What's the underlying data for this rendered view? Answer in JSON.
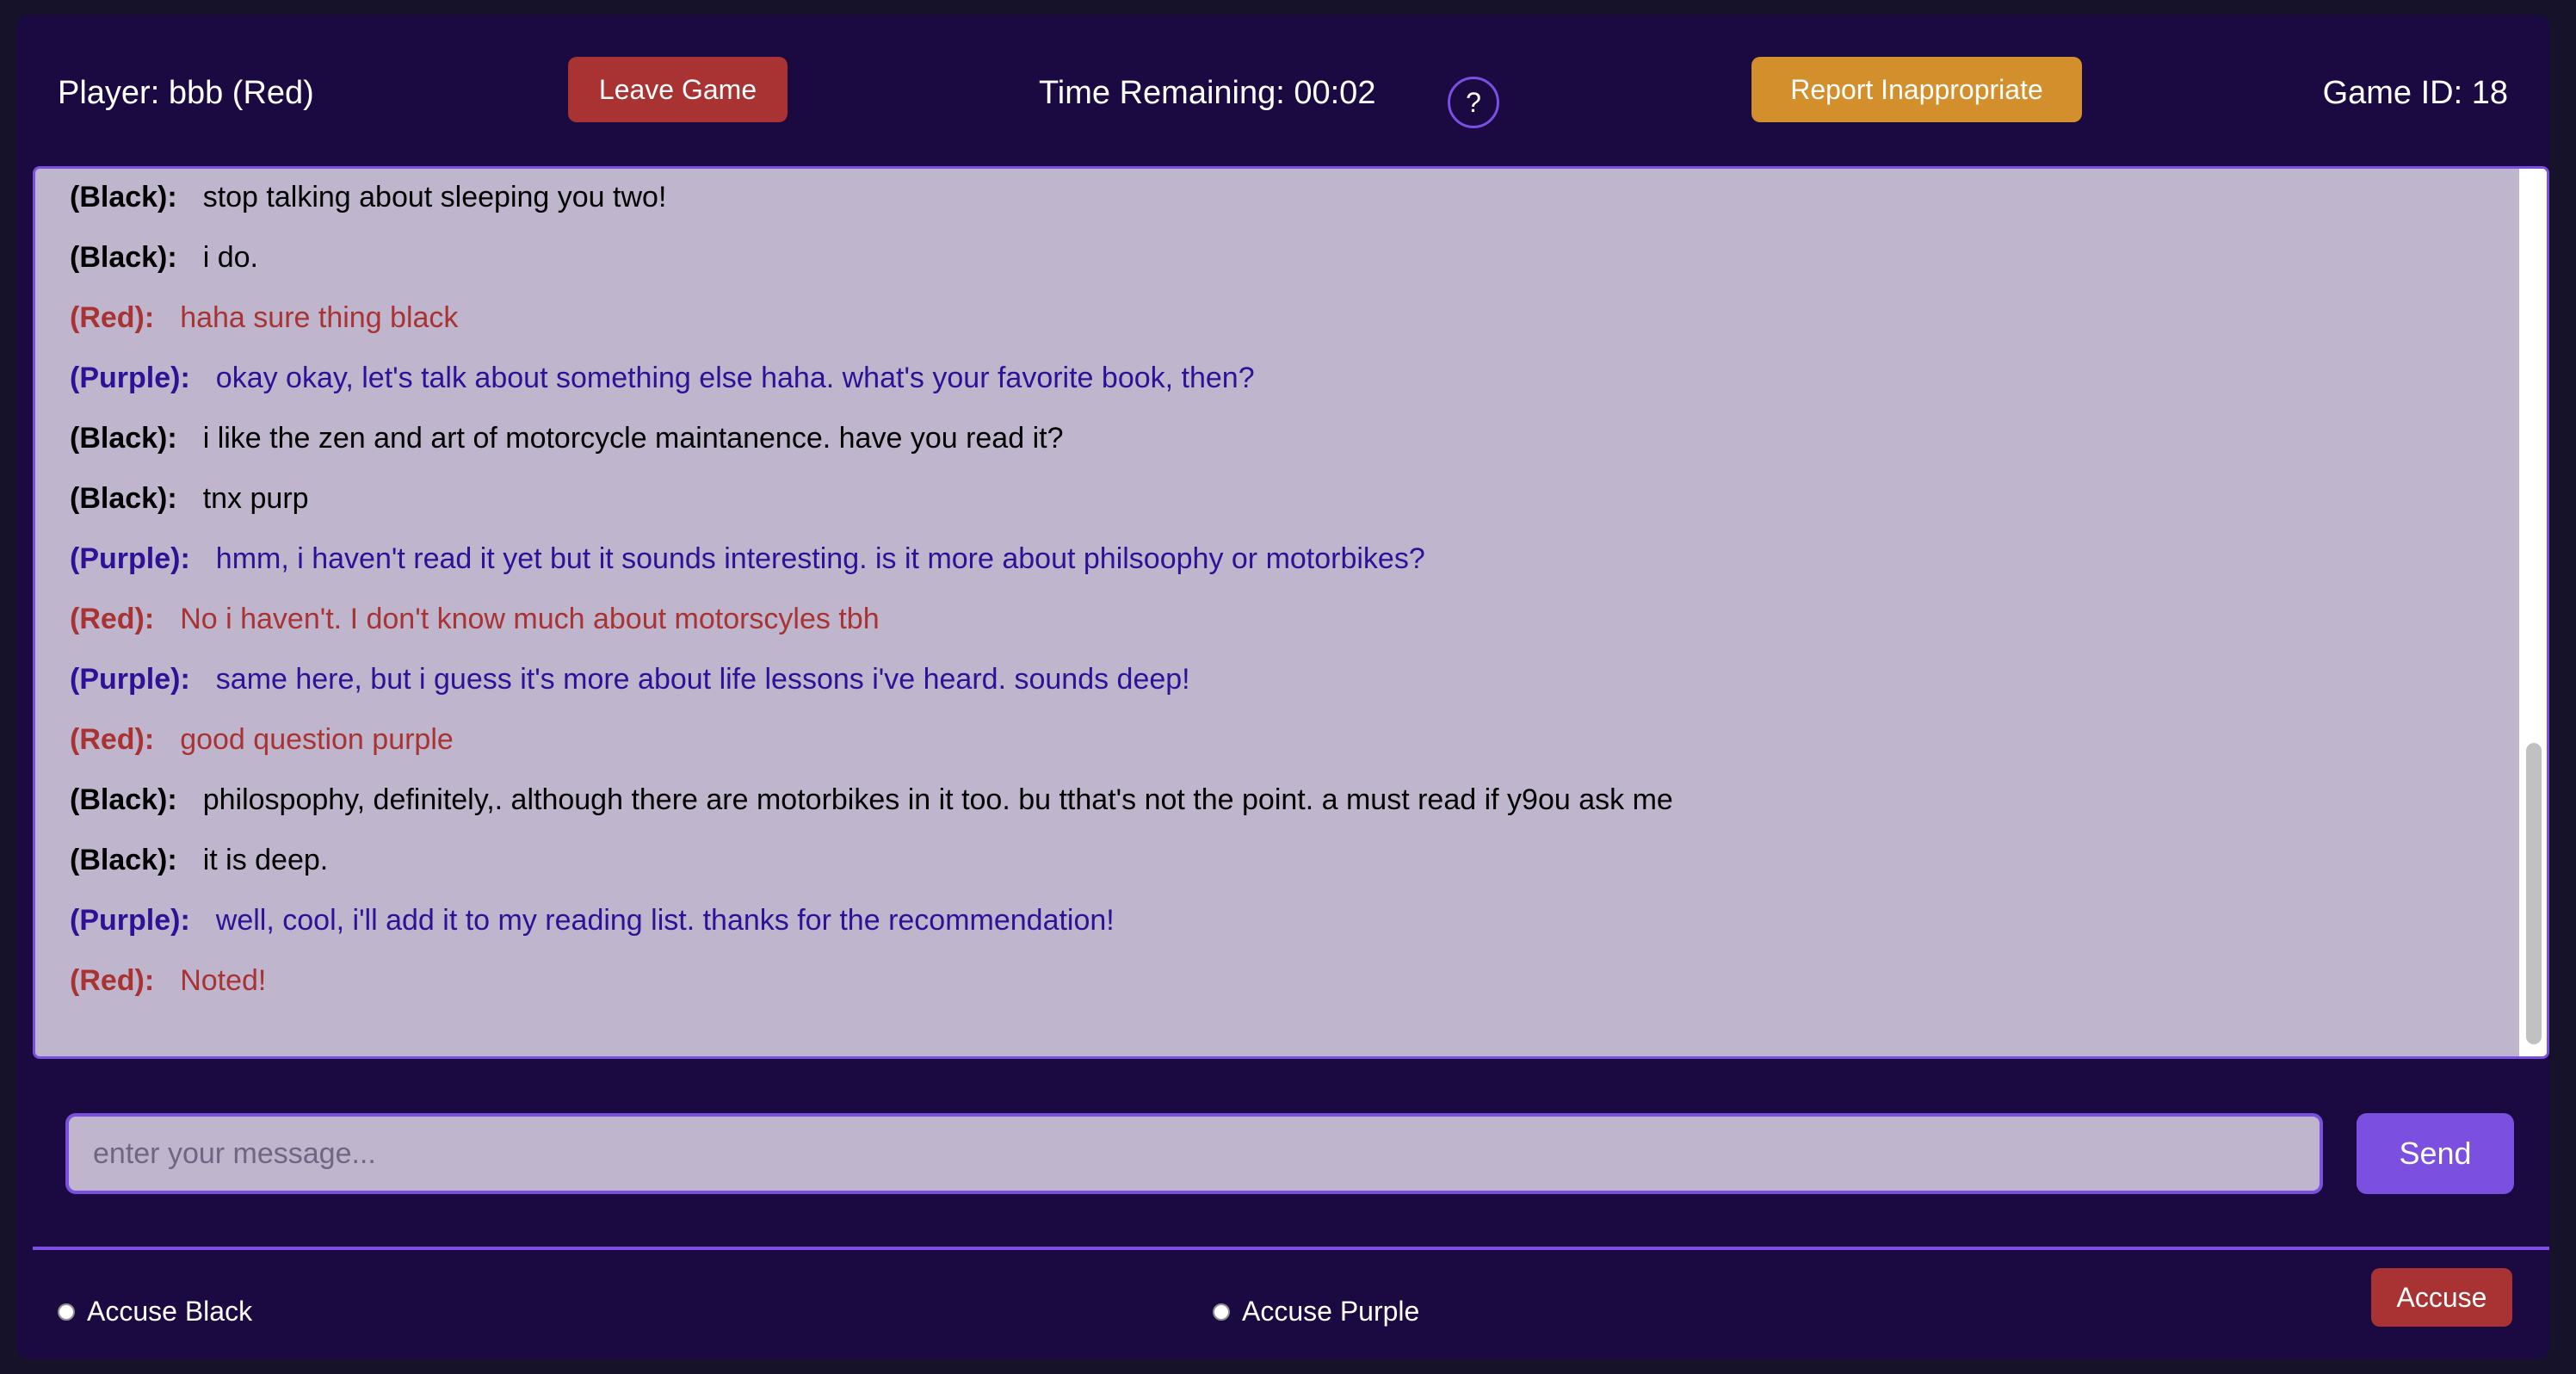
{
  "header": {
    "player_label": "Player: bbb (Red)",
    "leave_label": "Leave Game",
    "timer_label": "Time Remaining: 00:02",
    "help_label": "?",
    "report_label": "Report Inappropriate",
    "game_id_label": "Game ID: 18"
  },
  "colors": {
    "background": "#1b0a41",
    "accent": "#7b4fe0",
    "leave_button": "#a93232",
    "report_button": "#d48f2d",
    "chat_background": "#bfb6ce",
    "speaker_black": "#000000",
    "speaker_red": "#a93232",
    "speaker_purple": "#2e1196"
  },
  "chat": {
    "messages": [
      {
        "speaker": "(Black):",
        "text": "stop talking about sleeping you two!",
        "color": "#000000"
      },
      {
        "speaker": "(Black):",
        "text": "i do.",
        "color": "#000000"
      },
      {
        "speaker": "(Red):",
        "text": "haha sure thing black",
        "color": "#a93232"
      },
      {
        "speaker": "(Purple):",
        "text": "okay okay, let's talk about something else haha. what's your favorite book, then?",
        "color": "#2e1196"
      },
      {
        "speaker": "(Black):",
        "text": "i like the zen and art of motorcycle maintanence. have you read it?",
        "color": "#000000"
      },
      {
        "speaker": "(Black):",
        "text": "tnx purp",
        "color": "#000000"
      },
      {
        "speaker": "(Purple):",
        "text": "hmm, i haven't read it yet but it sounds interesting. is it more about philsoophy or motorbikes?",
        "color": "#2e1196"
      },
      {
        "speaker": "(Red):",
        "text": "No i haven't. I don't know much about motorscyles tbh",
        "color": "#a93232"
      },
      {
        "speaker": "(Purple):",
        "text": "same here, but i guess it's more about life lessons i've heard. sounds deep!",
        "color": "#2e1196"
      },
      {
        "speaker": "(Red):",
        "text": "good question purple",
        "color": "#a93232"
      },
      {
        "speaker": "(Black):",
        "text": "philospophy, definitely,. although there are motorbikes in it too. bu tthat's not the point. a must read if y9ou ask me",
        "color": "#000000"
      },
      {
        "speaker": "(Black):",
        "text": "it is deep.",
        "color": "#000000"
      },
      {
        "speaker": "(Purple):",
        "text": "well, cool, i'll add it to my reading list. thanks for the recommendation!",
        "color": "#2e1196"
      },
      {
        "speaker": "(Red):",
        "text": "Noted!",
        "color": "#a93232"
      }
    ]
  },
  "composer": {
    "placeholder": "enter your message...",
    "value": "",
    "send_label": "Send"
  },
  "accuse": {
    "options": [
      {
        "label": "Accuse Black",
        "selected": false
      },
      {
        "label": "Accuse Purple",
        "selected": false
      }
    ],
    "button_label": "Accuse"
  }
}
